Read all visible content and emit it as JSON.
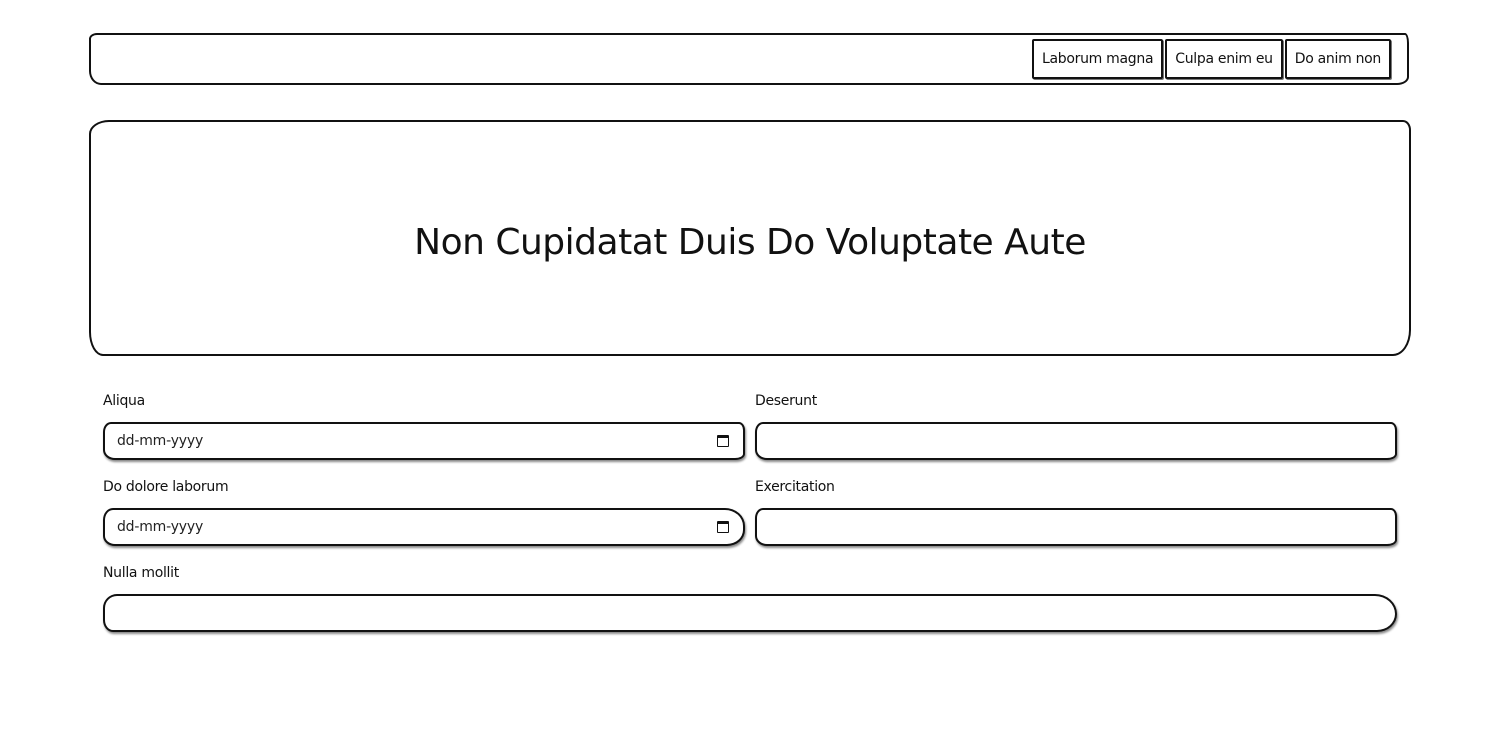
{
  "nav": {
    "items": [
      {
        "label": "Laborum magna"
      },
      {
        "label": "Culpa enim eu"
      },
      {
        "label": "Do anim non"
      }
    ]
  },
  "hero": {
    "title": "Non Cupidatat Duis Do Voluptate Aute"
  },
  "form": {
    "aliqua": {
      "label": "Aliqua",
      "value": "dd-mm-yyyy",
      "icon": "calendar-icon"
    },
    "deserunt": {
      "label": "Deserunt",
      "value": ""
    },
    "do_dolore_laborum": {
      "label": "Do dolore laborum",
      "value": "dd-mm-yyyy",
      "icon": "calendar-icon"
    },
    "exercitation": {
      "label": "Exercitation",
      "value": ""
    },
    "nulla_mollit": {
      "label": "Nulla mollit",
      "value": ""
    }
  }
}
